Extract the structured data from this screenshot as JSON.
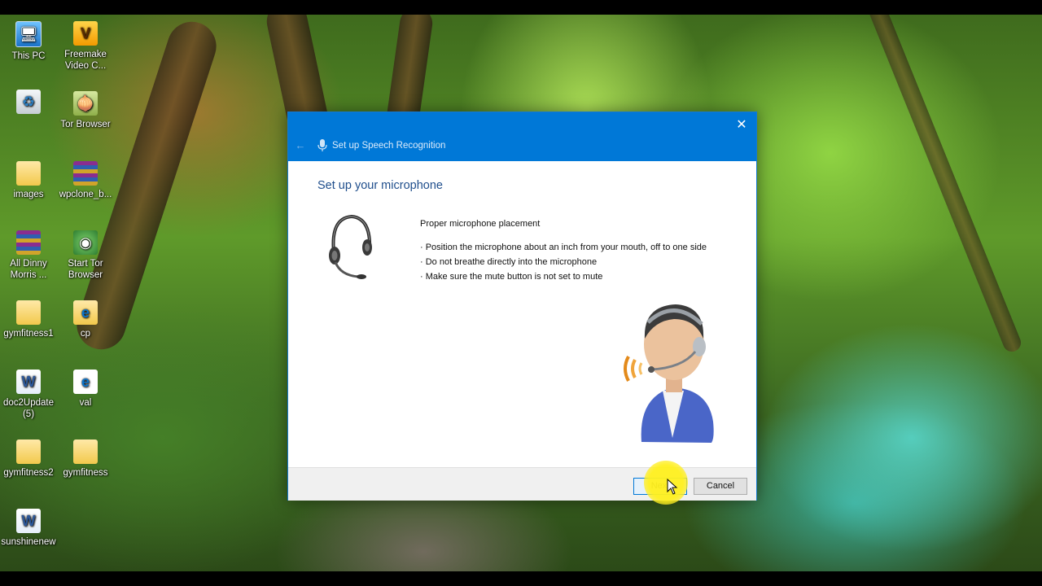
{
  "desktop": {
    "icons": [
      {
        "label": "This PC",
        "glyph": "🖥",
        "icon": "computer-icon"
      },
      {
        "label": "Freemake\nVideo C...",
        "glyph": "V",
        "icon": "freemake-icon"
      },
      {
        "label": "",
        "glyph": "♻",
        "icon": "recycle-bin-icon"
      },
      {
        "label": "Tor Browser",
        "glyph": "🧅",
        "icon": "tor-icon"
      },
      {
        "label": "images",
        "glyph": "",
        "icon": "folder-icon"
      },
      {
        "label": "wpclone_b...",
        "glyph": "",
        "icon": "winrar-archive-icon"
      },
      {
        "label": "All Dinny\nMorris ...",
        "glyph": "",
        "icon": "winrar-archive-icon"
      },
      {
        "label": "Start Tor\nBrowser",
        "glyph": "◉",
        "icon": "tor-start-icon"
      },
      {
        "label": "gymfitness1",
        "glyph": "",
        "icon": "folder-icon"
      },
      {
        "label": "cp",
        "glyph": "e",
        "icon": "folder-icon"
      },
      {
        "label": "doc2Update\n(5)",
        "glyph": "W",
        "icon": "word-document-icon"
      },
      {
        "label": "val",
        "glyph": "e",
        "icon": "edge-html-icon"
      },
      {
        "label": "gymfitness2",
        "glyph": "",
        "icon": "folder-icon"
      },
      {
        "label": "gymfitness",
        "glyph": "",
        "icon": "folder-icon"
      },
      {
        "label": "sunshinenew",
        "glyph": "W",
        "icon": "word-document-icon"
      }
    ]
  },
  "dialog": {
    "title": "Set up Speech Recognition",
    "close_glyph": "✕",
    "back_glyph": "←",
    "heading": "Set up your microphone",
    "placement_title": "Proper microphone placement",
    "instructions": [
      "· Position the microphone about an inch from your mouth, off to one side",
      "· Do not breathe directly into the microphone",
      "· Make sure the mute button is not set to mute"
    ],
    "next_label": "Next",
    "cancel_label": "Cancel",
    "accent_color": "#0078d7"
  }
}
